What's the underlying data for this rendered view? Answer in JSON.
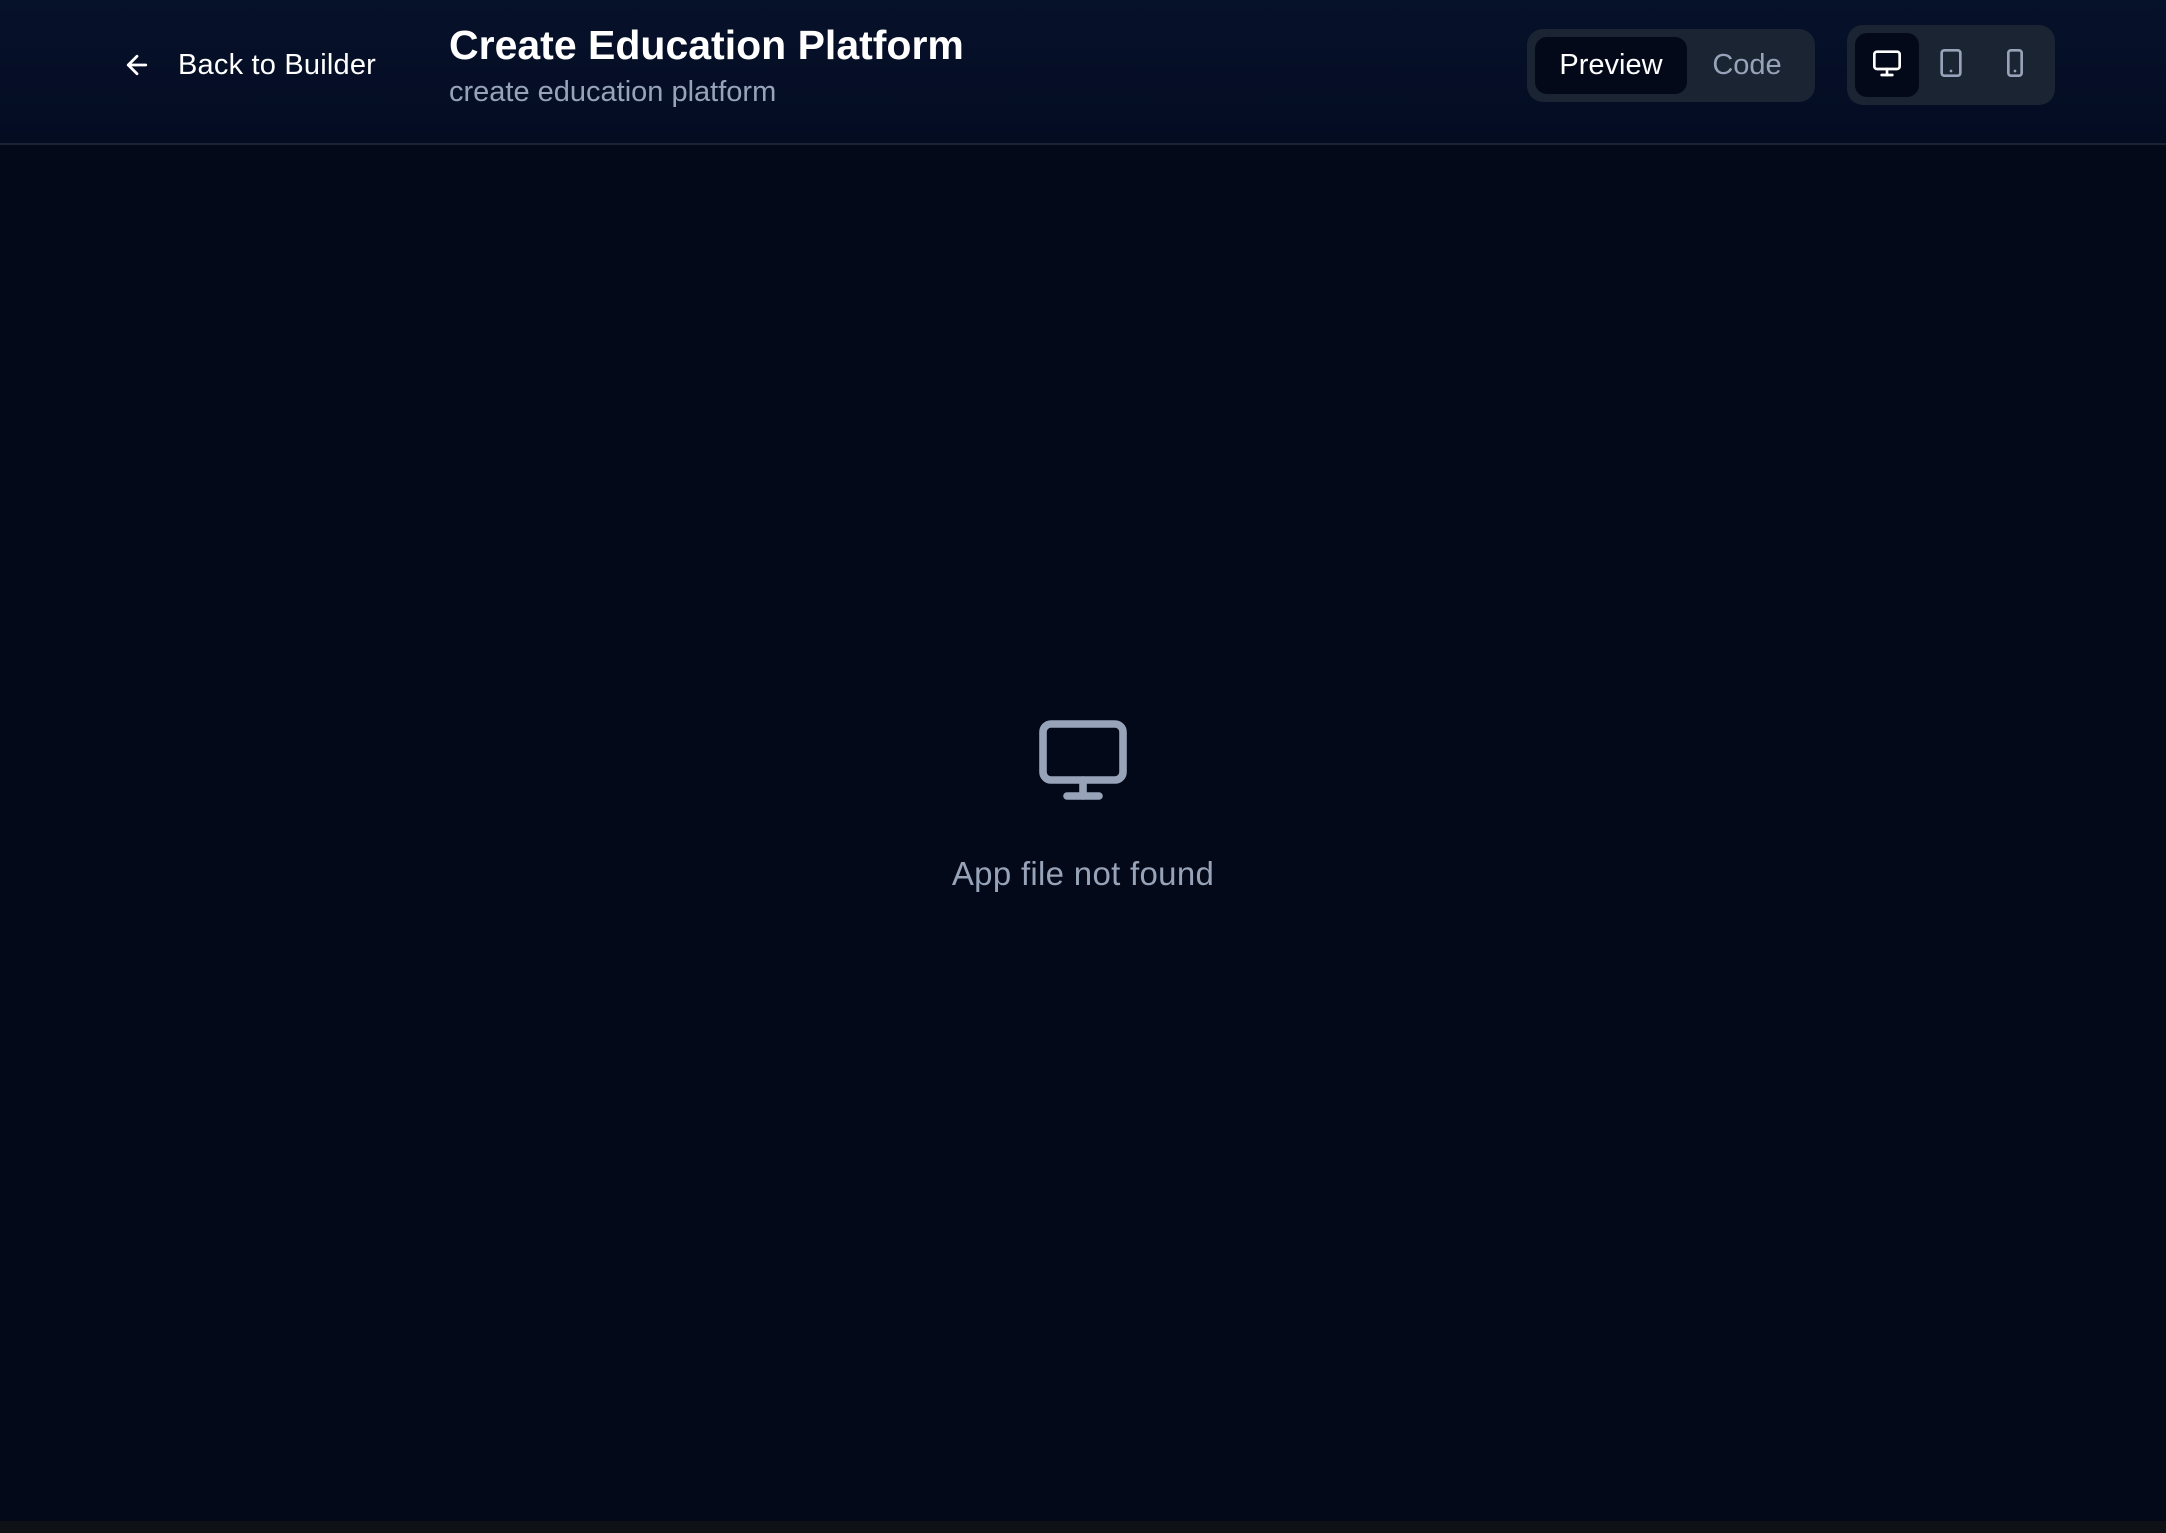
{
  "header": {
    "back_label": "Back to Builder",
    "back_icon": "arrow-left-icon",
    "title": "Create Education Platform",
    "subtitle": "create education platform"
  },
  "view_mode": {
    "options": [
      "Preview",
      "Code"
    ],
    "selected": "Preview"
  },
  "device_toggle": {
    "options": [
      "desktop-icon",
      "tablet-icon",
      "phone-icon"
    ],
    "selected": "desktop-icon"
  },
  "main": {
    "empty_icon": "monitor-icon",
    "message": "App file not found"
  },
  "colors": {
    "background": "#030918",
    "header_background": "#05102a",
    "toggle_background": "#1b2433",
    "muted_text": "#97a3b8",
    "primary_text": "#ffffff"
  }
}
